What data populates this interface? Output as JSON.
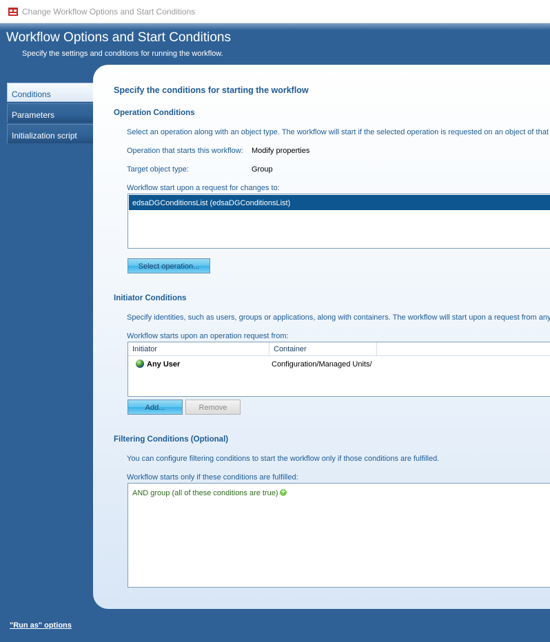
{
  "window": {
    "title": "Change Workflow Options and Start Conditions"
  },
  "header": {
    "title": "Workflow Options and Start Conditions",
    "subtitle": "Specify the settings and conditions for running the workflow."
  },
  "nav": {
    "items": [
      {
        "label": "Conditions"
      },
      {
        "label": "Parameters"
      },
      {
        "label": "Initialization script"
      }
    ]
  },
  "main": {
    "heading": "Specify the conditions for starting the workflow",
    "operation": {
      "title": "Operation Conditions",
      "description": "Select an operation along with an object type. The workflow will start if the selected operation is requested on an object of that",
      "op_label": "Operation that starts this workflow:",
      "op_value": "Modify properties",
      "target_label": "Target object type:",
      "target_value": "Group",
      "changes_label": "Workflow start upon a request for changes to:",
      "changes_items": [
        "edsaDGConditionsList (edsaDGConditionsList)"
      ],
      "select_button": "Select operation..."
    },
    "initiator": {
      "title": "Initiator Conditions",
      "description": "Specify identities, such as users, groups or applications, along with containers. The workflow will start upon a request from any",
      "list_label": "Workflow starts upon an operation request from:",
      "columns": [
        "Initiator",
        "Container"
      ],
      "rows": [
        {
          "initiator": "Any User",
          "container": "Configuration/Managed Units/"
        }
      ],
      "add_button": "Add...",
      "remove_button": "Remove"
    },
    "filtering": {
      "title": "Filtering Conditions (Optional)",
      "description": "You can configure filtering conditions to start the workflow only if those conditions are fulfilled.",
      "list_label": "Workflow starts only if these conditions are fulfilled:",
      "group_text": "AND group (all of these conditions are true)"
    }
  },
  "footer": {
    "run_as": "\"Run as\" options"
  },
  "colors": {
    "header_bg": "#2f6196",
    "accent": "#1e5b95",
    "selection": "#0d5690"
  },
  "icons": {
    "app": "workflow-app-icon",
    "user": "globe-icon",
    "add": "plus-circle-icon"
  }
}
